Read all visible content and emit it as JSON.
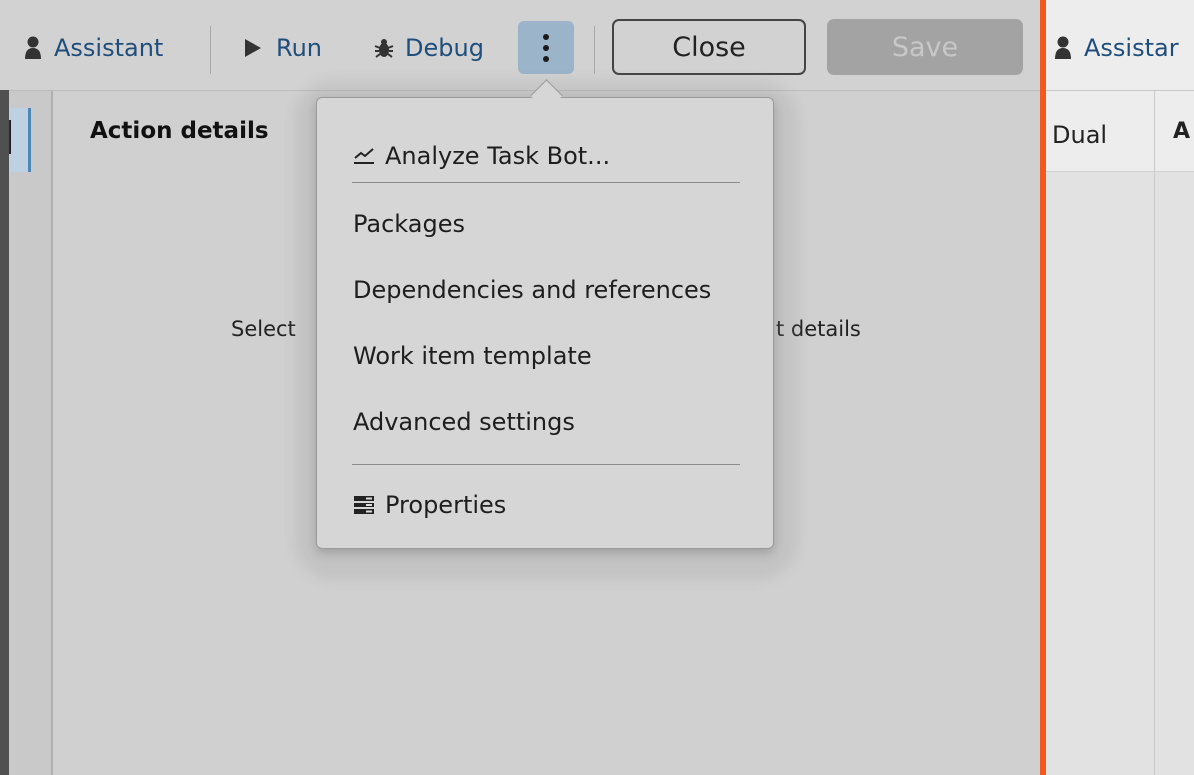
{
  "toolbar": {
    "assistant_label": "Assistant",
    "run_label": "Run",
    "debug_label": "Debug",
    "close_label": "Close",
    "save_label": "Save"
  },
  "panel": {
    "title": "Action details",
    "hint_left": "Select",
    "hint_right": "t details"
  },
  "menu": {
    "analyze": "Analyze Task Bot...",
    "packages": "Packages",
    "dependencies": "Dependencies and references",
    "work_item": "Work item template",
    "advanced": "Advanced settings",
    "properties": "Properties"
  },
  "right_pane": {
    "assistant_label": "Assistar",
    "tab_label": "Dual",
    "cut_label": "A"
  },
  "colors": {
    "accent_blue": "#1f4e7c",
    "kebab_bg": "#9bb4ca",
    "divider": "#f15a1f",
    "save_disabled": "#a3a3a3"
  }
}
